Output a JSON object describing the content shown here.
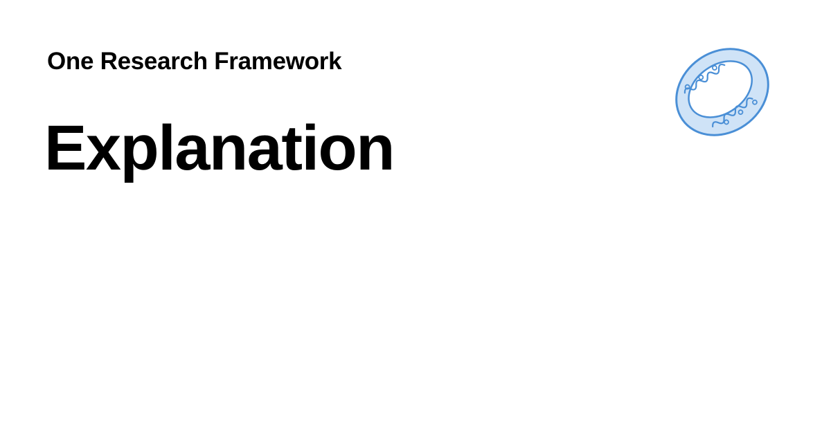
{
  "header": {
    "site_name": "One Research Framework"
  },
  "main": {
    "title": "Explanation"
  },
  "logo": {
    "icon": "ring-logo-icon",
    "colors": {
      "stroke": "#4a8fd6",
      "fill": "#cfe3f7",
      "inner": "#ffffff"
    }
  }
}
